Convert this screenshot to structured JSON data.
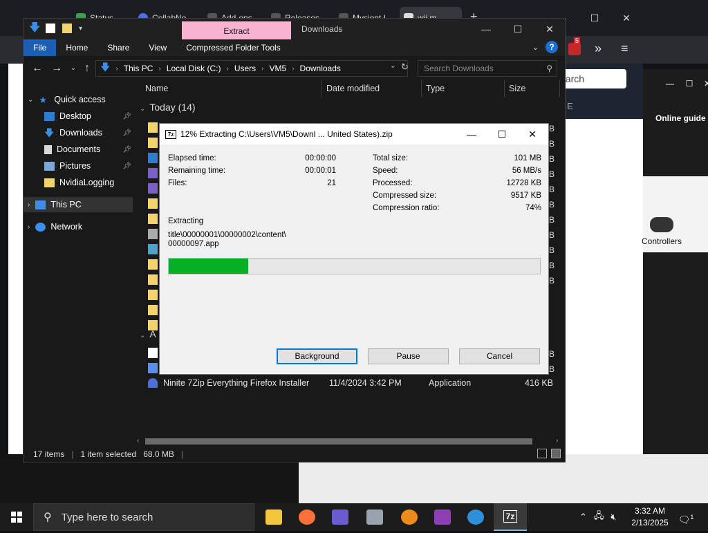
{
  "browser": {
    "tabs": [
      "Status",
      "CollabNo",
      "Add-ons",
      "Releases",
      "Mysiont I",
      "wii m"
    ],
    "search_partial": "earch",
    "side_text": "E",
    "online_guide": "Online guide",
    "controllers": "Controllers",
    "badge": "5"
  },
  "explorer": {
    "extract_tab": "Extract",
    "title": "Downloads",
    "ribbon": [
      "File",
      "Home",
      "Share",
      "View",
      "Compressed Folder Tools"
    ],
    "address": [
      "This PC",
      "Local Disk (C:)",
      "Users",
      "VM5",
      "Downloads"
    ],
    "search_placeholder": "Search Downloads",
    "nav": {
      "quick_access": "Quick access",
      "desktop": "Desktop",
      "downloads": "Downloads",
      "documents": "Documents",
      "pictures": "Pictures",
      "nvidia": "NvidiaLogging",
      "this_pc": "This PC",
      "network": "Network"
    },
    "columns": [
      "Name",
      "Date modified",
      "Type",
      "Size"
    ],
    "group_today": "Today (14)",
    "group_a": "A",
    "size_letter": "B",
    "file": {
      "name": "Ninite 7Zip Everything Firefox Installer",
      "date": "11/4/2024 3:42 PM",
      "type": "Application",
      "size": "416 KB"
    },
    "status": {
      "items": "17 items",
      "selected": "1 item selected",
      "size": "68.0 MB"
    }
  },
  "dialog": {
    "title": "12% Extracting C:\\Users\\VM5\\Downl ... United States).zip",
    "icon_text": "7z",
    "left": [
      {
        "label": "Elapsed time:",
        "value": "00:00:00"
      },
      {
        "label": "Remaining time:",
        "value": "00:00:01"
      },
      {
        "label": "Files:",
        "value": "21"
      }
    ],
    "right": [
      {
        "label": "Total size:",
        "value": "101 MB"
      },
      {
        "label": "Speed:",
        "value": "56 MB/s"
      },
      {
        "label": "Processed:",
        "value": "12728 KB"
      },
      {
        "label": "Compressed size:",
        "value": "9517 KB"
      },
      {
        "label": "Compression ratio:",
        "value": "74%"
      }
    ],
    "operation": "Extracting",
    "current_file_line1": "title\\00000001\\00000002\\content\\",
    "current_file_line2": "00000097.app",
    "progress_fraction": 0.215,
    "progress_color": "#06b025",
    "buttons": {
      "background": "Background",
      "pause": "Pause",
      "cancel": "Cancel"
    }
  },
  "taskbar": {
    "search_placeholder": "Type here to search",
    "time": "3:32 AM",
    "date": "2/13/2025",
    "seven_zip": "7z",
    "notifications": "1"
  }
}
